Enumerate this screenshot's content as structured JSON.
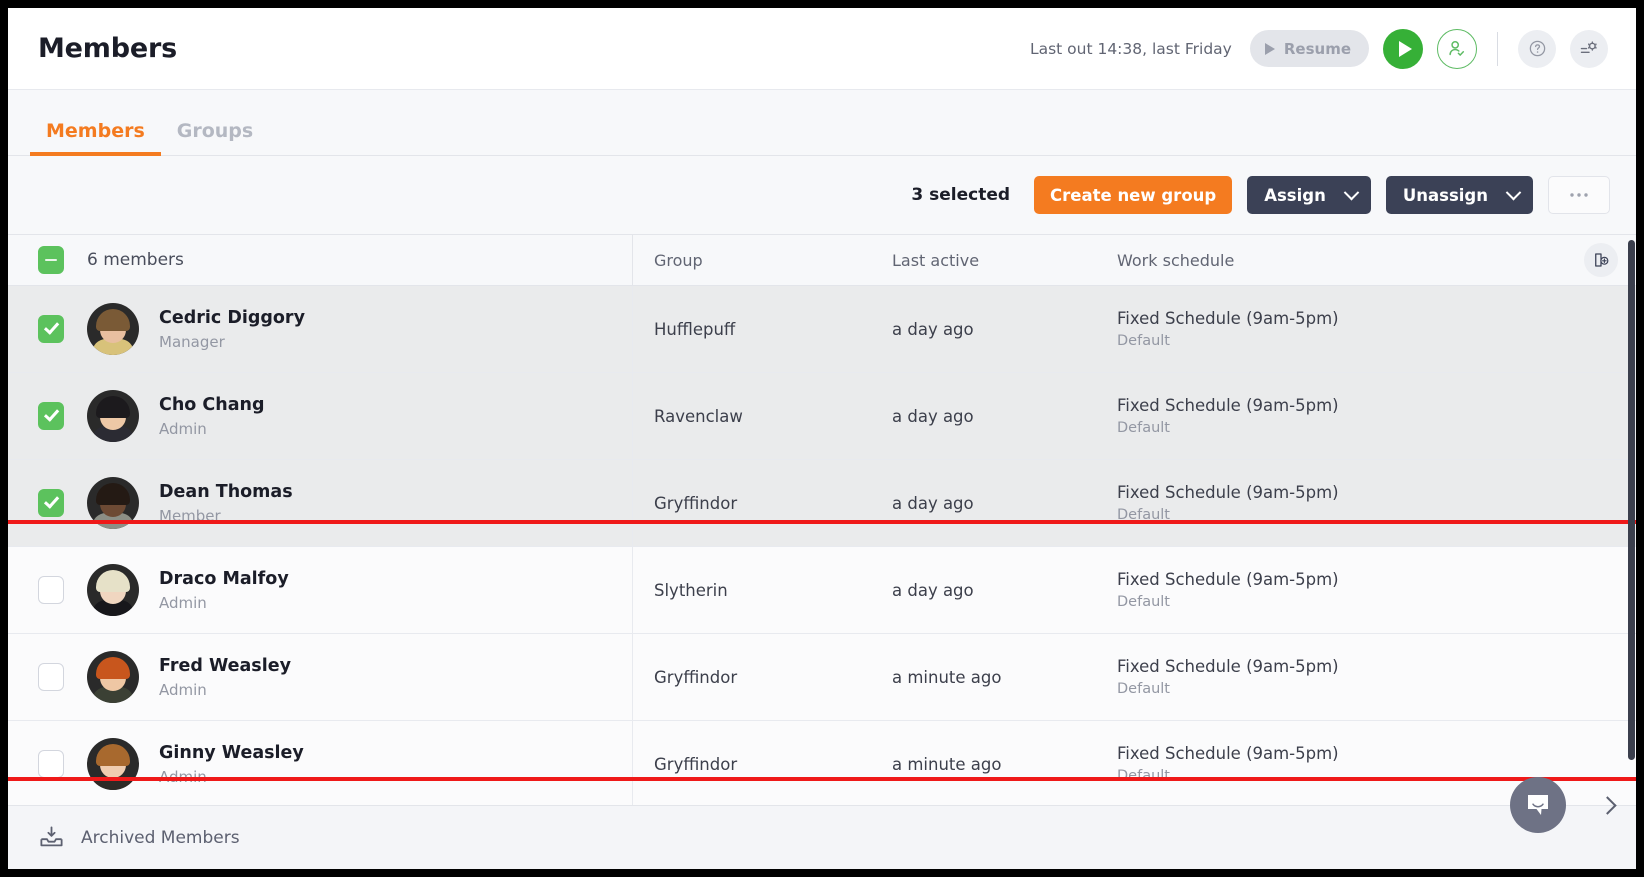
{
  "header": {
    "title": "Members",
    "last_out": "Last out 14:38, last Friday",
    "resume_label": "Resume",
    "play_icon": "play-icon",
    "person_check_icon": "person-check-icon",
    "help_icon": "help-circle-icon",
    "settings_icon": "settings-icon"
  },
  "tabs": [
    {
      "label": "Members",
      "active": true
    },
    {
      "label": "Groups",
      "active": false
    }
  ],
  "actionbar": {
    "selected_count": "3 selected",
    "create_group_label": "Create new group",
    "assign_label": "Assign",
    "unassign_label": "Unassign",
    "more_label": "●●●"
  },
  "table": {
    "select_all_state": "indeterminate",
    "members_count": "6 members",
    "columns": {
      "group": "Group",
      "last_active": "Last active",
      "work_schedule": "Work schedule"
    },
    "add_column_icon": "add-column-icon",
    "rows": [
      {
        "name": "Cedric Diggory",
        "role": "Manager",
        "group": "Hufflepuff",
        "last_active": "a day ago",
        "schedule": "Fixed Schedule (9am-5pm)",
        "schedule_sub": "Default",
        "selected": true
      },
      {
        "name": "Cho Chang",
        "role": "Admin",
        "group": "Ravenclaw",
        "last_active": "a day ago",
        "schedule": "Fixed Schedule (9am-5pm)",
        "schedule_sub": "Default",
        "selected": true
      },
      {
        "name": "Dean Thomas",
        "role": "Member",
        "group": "Gryffindor",
        "last_active": "a day ago",
        "schedule": "Fixed Schedule (9am-5pm)",
        "schedule_sub": "Default",
        "selected": true
      },
      {
        "name": "Draco Malfoy",
        "role": "Admin",
        "group": "Slytherin",
        "last_active": "a day ago",
        "schedule": "Fixed Schedule (9am-5pm)",
        "schedule_sub": "Default",
        "selected": false
      },
      {
        "name": "Fred Weasley",
        "role": "Admin",
        "group": "Gryffindor",
        "last_active": "a minute ago",
        "schedule": "Fixed Schedule (9am-5pm)",
        "schedule_sub": "Default",
        "selected": false
      },
      {
        "name": "Ginny Weasley",
        "role": "Admin",
        "group": "Gryffindor",
        "last_active": "a minute ago",
        "schedule": "Fixed Schedule (9am-5pm)",
        "schedule_sub": "Default",
        "selected": false
      }
    ]
  },
  "footer": {
    "archived_label": "Archived Members",
    "archive_icon": "archive-download-icon",
    "chat_icon": "chat-bubble-icon",
    "expand_icon": "chevron-right-icon"
  },
  "colors": {
    "accent_orange": "#f47b20",
    "navy": "#3b4156",
    "green": "#36b037",
    "checkbox_green": "#5cc25d",
    "highlight_red": "#ef1919"
  },
  "avatar_palette": [
    {
      "hair": "#7a5a36",
      "face": "#e8bfa0",
      "body": "#d8c27a"
    },
    {
      "hair": "#1c1a1d",
      "face": "#edc8a6",
      "body": "#2b2b33"
    },
    {
      "hair": "#241a14",
      "face": "#6d4a34",
      "body": "#8c8f86"
    },
    {
      "hair": "#e6e1c8",
      "face": "#f0d6c0",
      "body": "#17171b"
    },
    {
      "hair": "#c8561d",
      "face": "#efc7a4",
      "body": "#3b4034"
    },
    {
      "hair": "#a8692e",
      "face": "#f0cdb0",
      "body": "#2e2a26"
    }
  ]
}
